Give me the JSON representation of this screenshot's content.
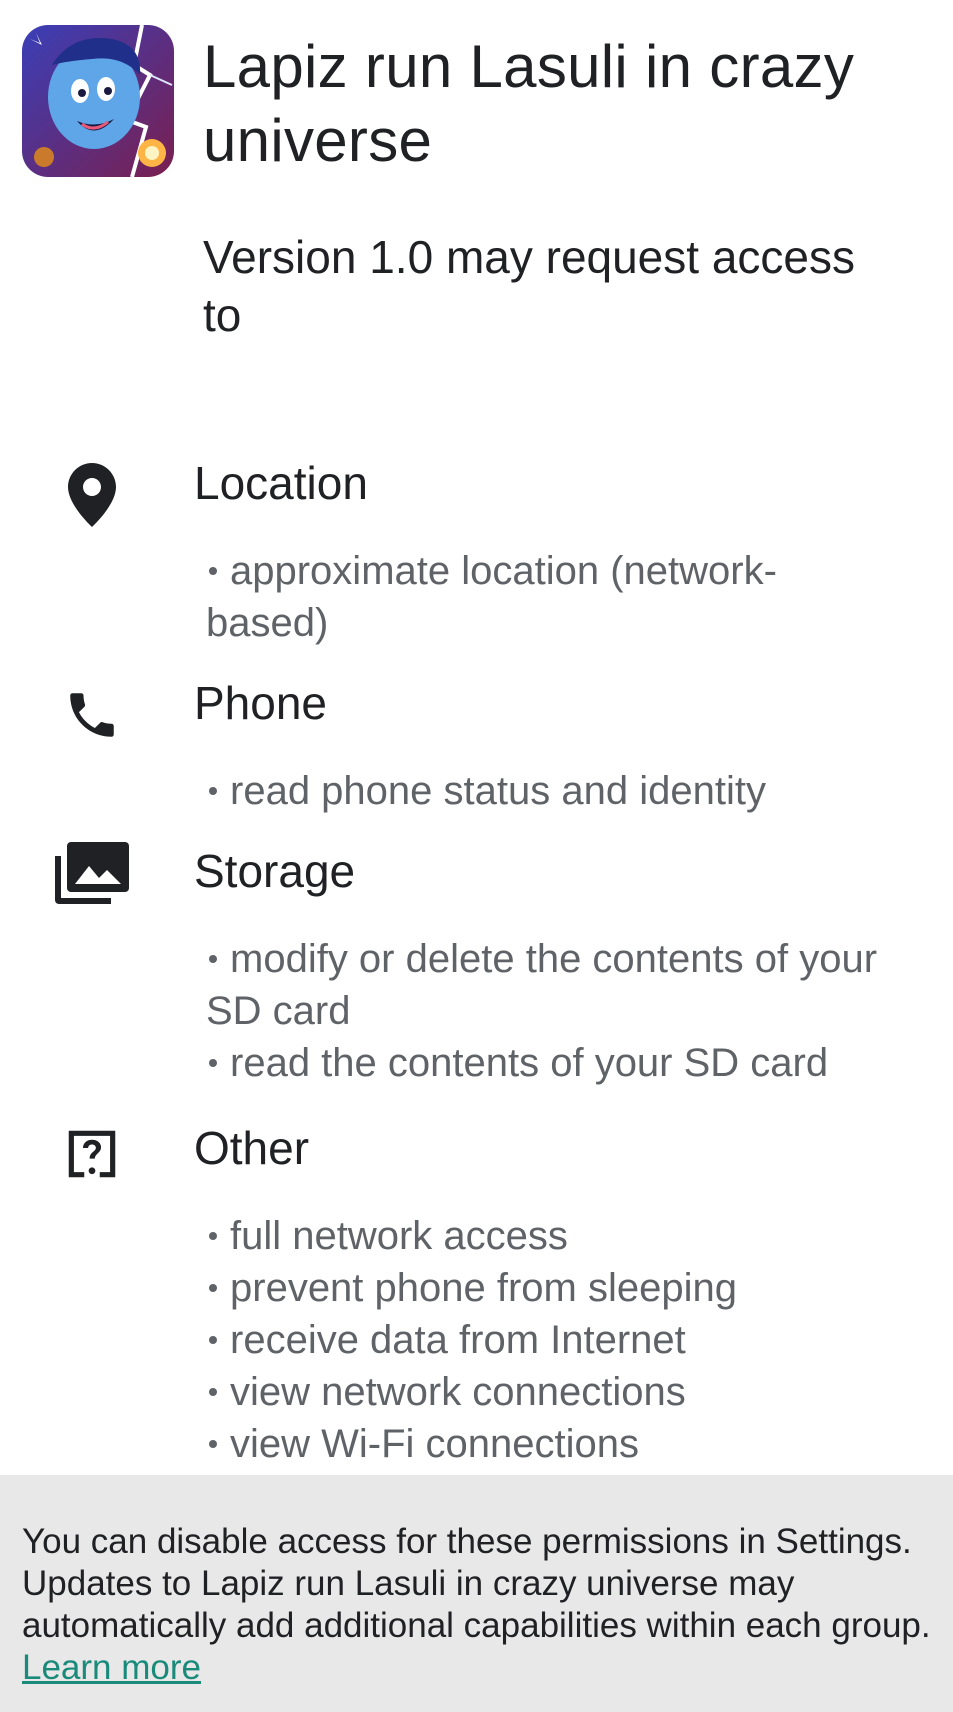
{
  "app": {
    "icon": "cartoon-character-app-icon",
    "title": "Lapiz run Lasuli in crazy universe",
    "version_text": "Version 1.0 may request access to"
  },
  "groups": [
    {
      "icon": "location-pin-icon",
      "title": "Location",
      "permissions": [
        "approximate location (network-based)"
      ]
    },
    {
      "icon": "phone-icon",
      "title": "Phone",
      "permissions": [
        "read phone status and identity"
      ]
    },
    {
      "icon": "photo-library-icon",
      "title": "Storage",
      "permissions": [
        "modify or delete the contents of your SD card",
        "read the contents of your SD card"
      ]
    },
    {
      "icon": "help-question-icon",
      "title": "Other",
      "permissions": [
        "full network access",
        "prevent phone from sleeping",
        "receive data from Internet",
        "view network connections",
        "view Wi-Fi connections"
      ]
    }
  ],
  "footer": {
    "text": "You can disable access for these permissions in Settings. Updates to Lapiz run Lasuli in crazy universe may automatically add additional capabilities within each group. ",
    "link_label": "Learn more"
  },
  "colors": {
    "link": "#1a8b7b",
    "footer_bg": "#e8e8e8",
    "secondary_text": "#5f6368"
  }
}
